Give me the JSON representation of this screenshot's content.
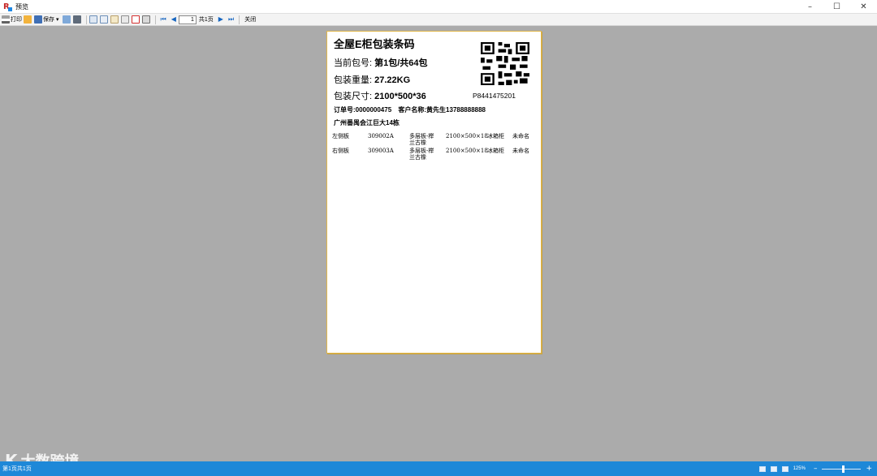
{
  "window": {
    "title": "预览"
  },
  "toolbar": {
    "print_label": "打印",
    "save_label": "保存",
    "page_current": "1",
    "page_total": "共1页",
    "close_label": "关闭"
  },
  "label": {
    "title": "全屋E柜包装条码",
    "package_no_key": "当前包号:",
    "package_no_value": "第1包/共64包",
    "weight_key": "包装重量:",
    "weight_value": "27.22KG",
    "size_key": "包装尺寸:",
    "size_value": "2100*500*36",
    "barcode_text": "P8441475201",
    "order_no": "订单号:0000000475",
    "customer": "客户名称:黄先生13788888888",
    "address": "广州番禺会江巨大14栋",
    "items": [
      {
        "name": "左侧板",
        "code": "309002A",
        "material_1": "多层板-榉",
        "material_2": "兰古橡",
        "dimensions": "2100×500×18",
        "cabinet": "冰箱柜",
        "note": "未命名"
      },
      {
        "name": "右侧板",
        "code": "309003A",
        "material_1": "多层板-榉",
        "material_2": "兰古橡",
        "dimensions": "2100×500×18",
        "cabinet": "冰箱柜",
        "note": "未命名"
      }
    ]
  },
  "watermark": {
    "text": "大数跨境"
  },
  "status": {
    "left_text": "第1页共1页",
    "zoom": "125%",
    "zoom_fraction": 0.55
  },
  "icons": {
    "app": "report-viewer-icon",
    "print": "printer-icon",
    "open": "folder-open-icon",
    "save": "floppy-disk-icon"
  },
  "colors": {
    "statusbar": "#1e88d8",
    "page_border": "#e0b64a",
    "nav_arrow": "#1565c0"
  }
}
